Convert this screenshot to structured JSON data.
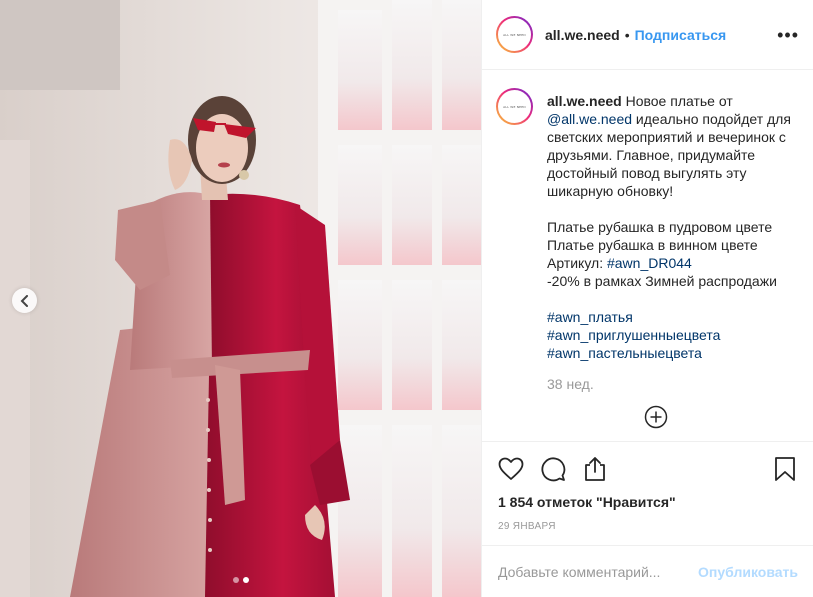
{
  "post": {
    "username": "all.we.need",
    "avatar_logo": "ALL WE NEED",
    "separator": "•",
    "follow_label": "Подписаться",
    "more_label": "•••"
  },
  "caption": {
    "username": "all.we.need",
    "text_1": " Новое платье от ",
    "mention": "@all.we.need",
    "text_2": " идеально подойдет для светских мероприятий и вечеринок с друзьями. Главное, придумайте достойный повод выгулять эту шикарную обновку!",
    "line_1": "Платье рубашка в пудровом цвете",
    "line_2": "Платье рубашка в винном цвете",
    "article_prefix": "Артикул: ",
    "article_tag": "#awn_DR044",
    "line_4": "-20% в рамках Зимней распродажи",
    "hashtags": [
      "#awn_платья",
      "#awn_приглушенныецвета",
      "#awn_пастельныецвета"
    ],
    "time": "38 нед."
  },
  "icons": {
    "prev": "chevron-left-icon",
    "load_more": "plus-circle-icon",
    "like": "heart-icon",
    "comment": "comment-icon",
    "share": "share-icon",
    "save": "bookmark-icon"
  },
  "likes_text": "1 854 отметок \"Нравится\"",
  "date_text": "29 ЯНВАРЯ",
  "comment_form": {
    "placeholder": "Добавьте комментарий...",
    "publish_label": "Опубликовать"
  },
  "carousel": {
    "count": 2,
    "active": 2
  },
  "colors": {
    "accent": "#3897f0",
    "link": "#003569",
    "publish_disabled": "#b3dbff",
    "dress_powder": "#c98f8f",
    "dress_wine": "#b8103a"
  }
}
